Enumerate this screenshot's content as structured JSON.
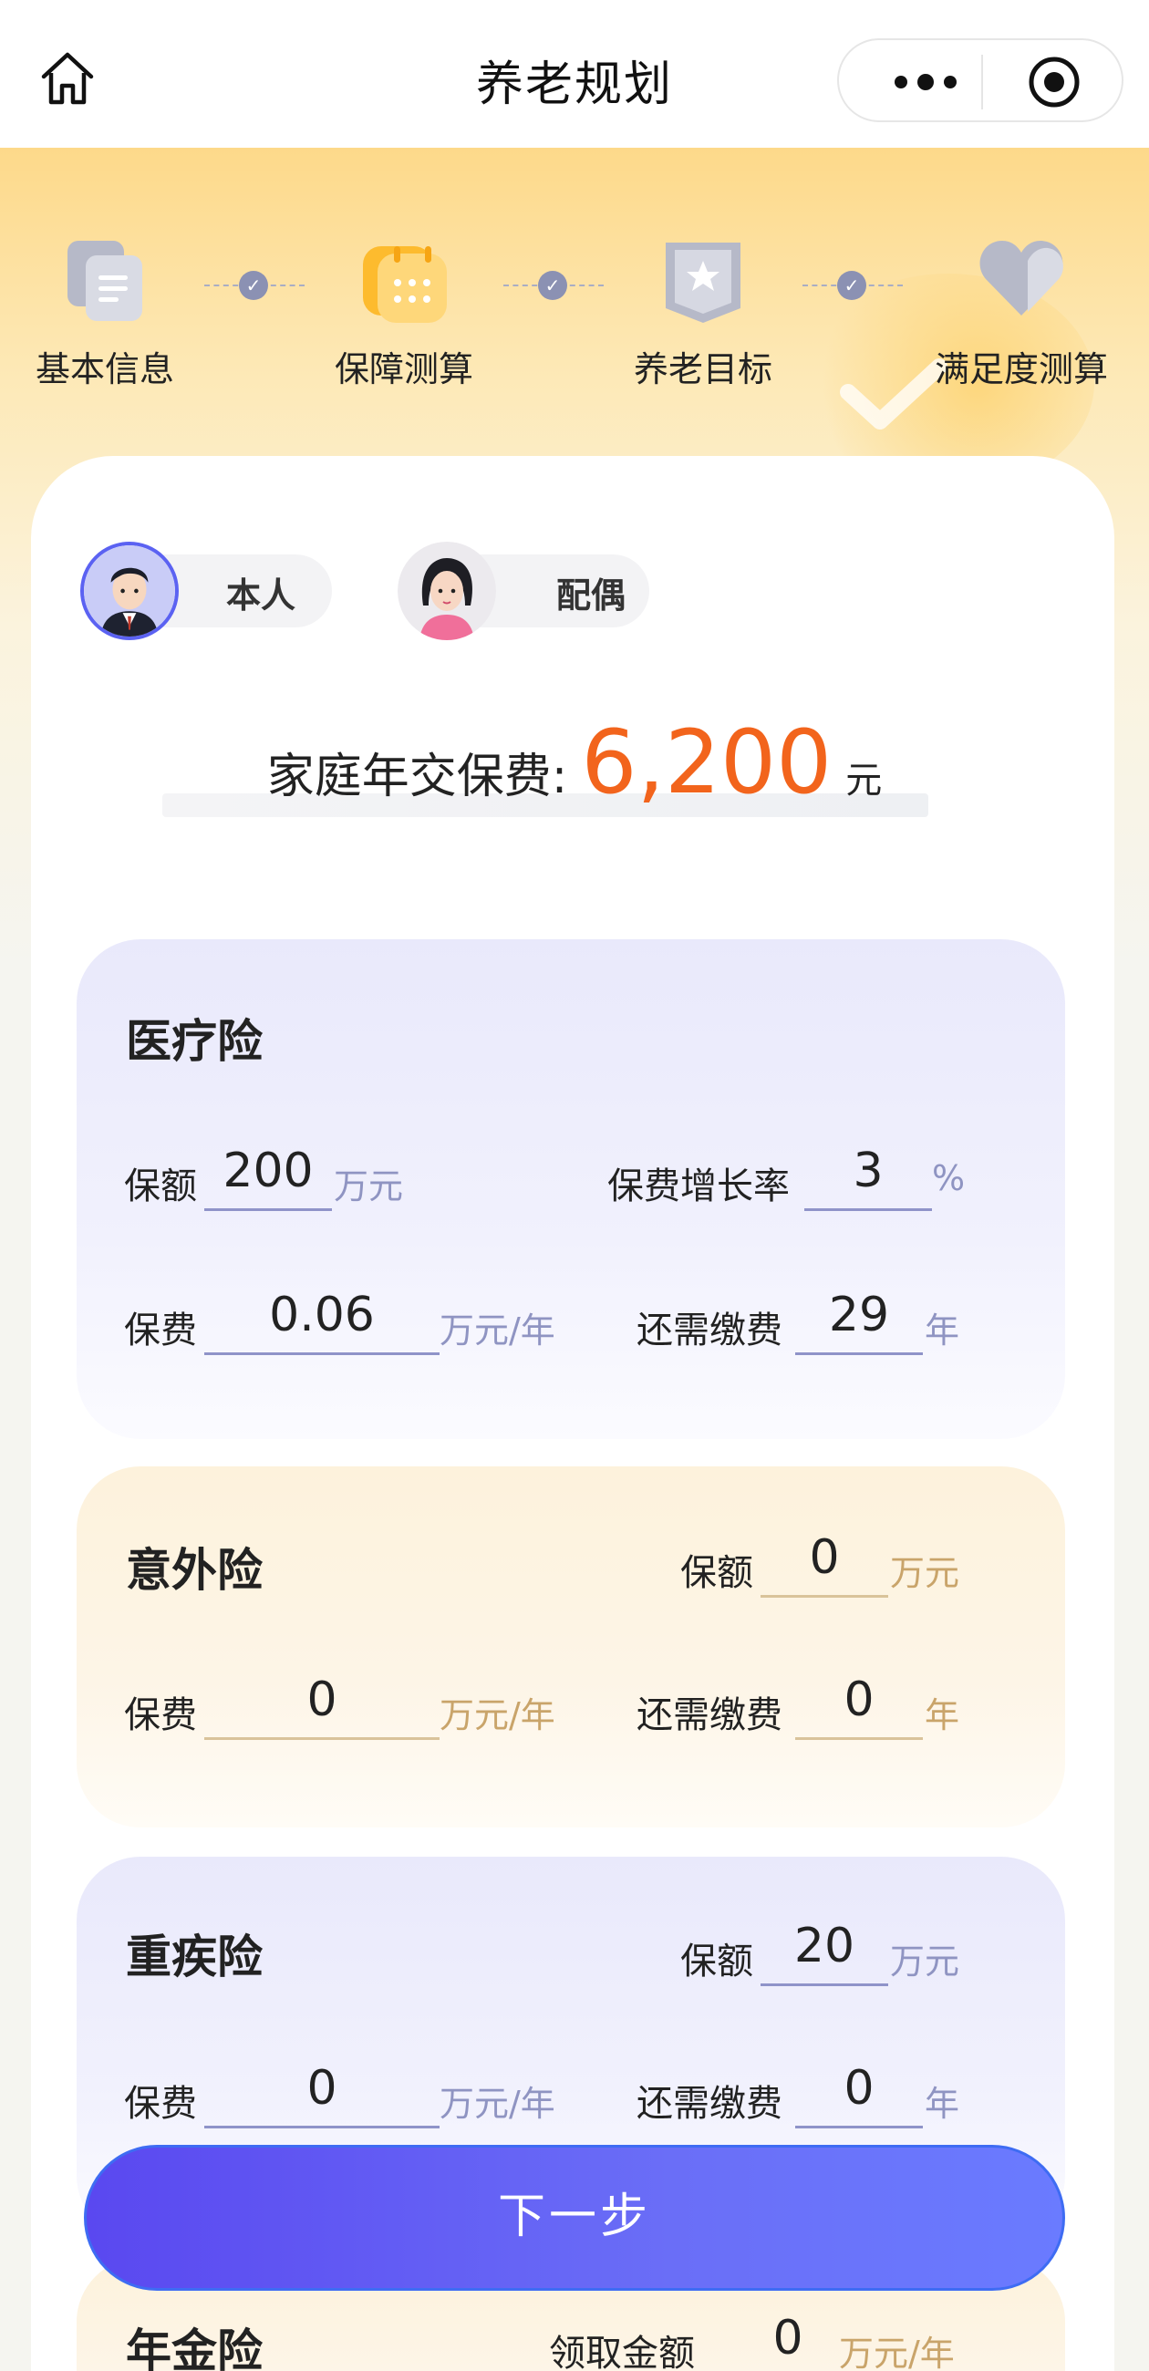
{
  "header": {
    "title": "养老规划"
  },
  "steps": [
    {
      "label": "基本信息"
    },
    {
      "label": "保障测算"
    },
    {
      "label": "养老目标"
    },
    {
      "label": "满足度测算"
    }
  ],
  "persons": [
    {
      "label": "本人",
      "selected": true
    },
    {
      "label": "配偶",
      "selected": false
    }
  ],
  "family_fee": {
    "label": "家庭年交保费:",
    "value": "6,200",
    "unit": "元"
  },
  "medical": {
    "title": "医疗险",
    "coverage_label": "保额",
    "coverage_value": "200",
    "coverage_unit": "万元",
    "growth_label": "保费增长率",
    "growth_value": "3",
    "growth_unit": "%",
    "premium_label": "保费",
    "premium_value": "0.06",
    "premium_unit": "万元/年",
    "remain_label": "还需缴费",
    "remain_value": "29",
    "remain_unit": "年"
  },
  "accident": {
    "title": "意外险",
    "coverage_label": "保额",
    "coverage_value": "0",
    "coverage_unit": "万元",
    "premium_label": "保费",
    "premium_value": "0",
    "premium_unit": "万元/年",
    "remain_label": "还需缴费",
    "remain_value": "0",
    "remain_unit": "年"
  },
  "critical": {
    "title": "重疾险",
    "coverage_label": "保额",
    "coverage_value": "20",
    "coverage_unit": "万元",
    "premium_label": "保费",
    "premium_value": "0",
    "premium_unit": "万元/年",
    "remain_label": "还需缴费",
    "remain_value": "0",
    "remain_unit": "年"
  },
  "annuity": {
    "title": "年金险",
    "receive_label": "领取金额",
    "receive_value": "0",
    "receive_unit": "万元/年"
  },
  "next_button": {
    "label": "下一步"
  },
  "colors": {
    "accent": "#f2641c",
    "button": "#5a48f0",
    "step_line": "#8b91b3"
  }
}
